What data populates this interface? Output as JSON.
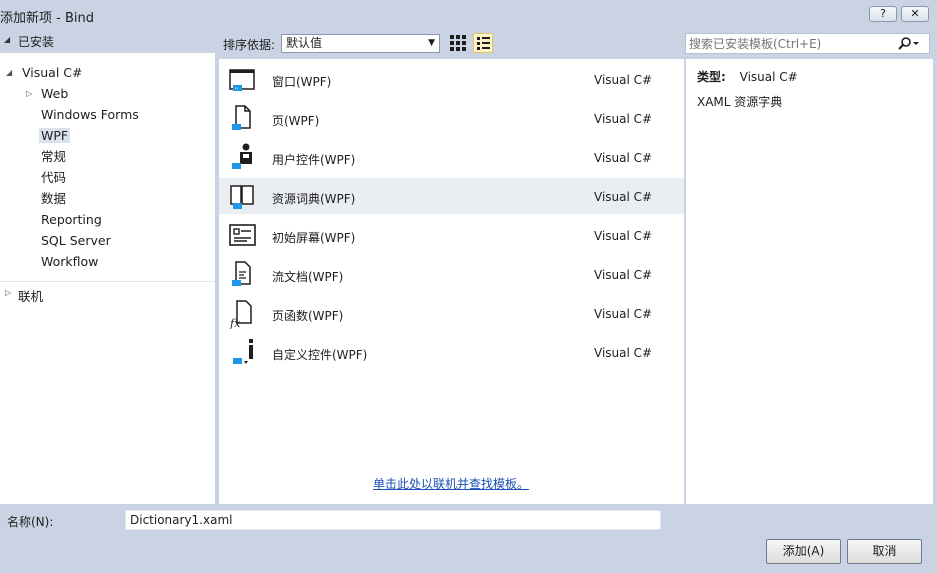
{
  "window": {
    "title": "添加新项 - Bind",
    "help_label": "?",
    "close_label": "✕"
  },
  "sidebar": {
    "installed_label": "已安装",
    "root_label": "Visual C#",
    "items": [
      {
        "label": "Web"
      },
      {
        "label": "Windows Forms"
      },
      {
        "label": "WPF"
      },
      {
        "label": "常规"
      },
      {
        "label": "代码"
      },
      {
        "label": "数据"
      },
      {
        "label": "Reporting"
      },
      {
        "label": "SQL Server"
      },
      {
        "label": "Workflow"
      }
    ],
    "online_label": "联机"
  },
  "toolbar": {
    "sort_label": "排序依据:",
    "sort_value": "默认值"
  },
  "search": {
    "placeholder": "搜索已安装模板(Ctrl+E)"
  },
  "templates": [
    {
      "name": "窗口(WPF)",
      "lang": "Visual C#",
      "icon": "window-icon"
    },
    {
      "name": "页(WPF)",
      "lang": "Visual C#",
      "icon": "page-icon"
    },
    {
      "name": "用户控件(WPF)",
      "lang": "Visual C#",
      "icon": "user-control-icon"
    },
    {
      "name": "资源词典(WPF)",
      "lang": "Visual C#",
      "icon": "resource-dictionary-icon"
    },
    {
      "name": "初始屏幕(WPF)",
      "lang": "Visual C#",
      "icon": "splash-screen-icon"
    },
    {
      "name": "流文档(WPF)",
      "lang": "Visual C#",
      "icon": "flow-document-icon"
    },
    {
      "name": "页函数(WPF)",
      "lang": "Visual C#",
      "icon": "page-function-icon"
    },
    {
      "name": "自定义控件(WPF)",
      "lang": "Visual C#",
      "icon": "custom-control-icon"
    }
  ],
  "online_link": "单击此处以联机并查找模板。",
  "details": {
    "type_key": "类型:",
    "type_value": "Visual C#",
    "description": "XAML 资源字典"
  },
  "footer": {
    "name_label": "名称(N):",
    "name_value": "Dictionary1.xaml",
    "add_label": "添加(A)",
    "cancel_label": "取消"
  },
  "colors": {
    "chrome": "#c9d3e3",
    "selected_row": "#eaedf1",
    "link": "#1a4eb5",
    "icon_blue": "#1c97ea"
  }
}
